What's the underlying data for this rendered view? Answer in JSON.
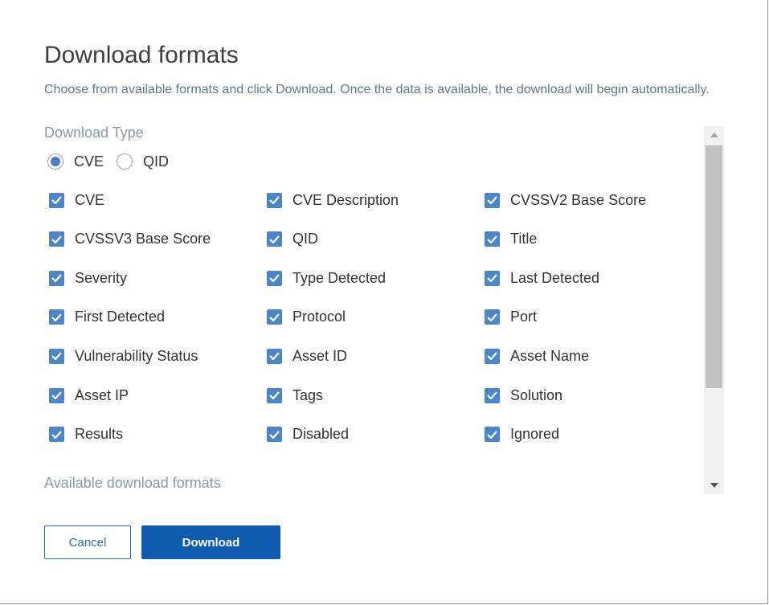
{
  "dialog": {
    "title": "Download formats",
    "description": "Choose from available formats and click Download. Once the data is available, the download will begin automatically."
  },
  "download_type": {
    "label": "Download Type",
    "options": [
      {
        "label": "CVE",
        "selected": true
      },
      {
        "label": "QID",
        "selected": false
      }
    ]
  },
  "fields": [
    {
      "label": "CVE",
      "checked": true
    },
    {
      "label": "CVE Description",
      "checked": true
    },
    {
      "label": "CVSSV2 Base Score",
      "checked": true
    },
    {
      "label": "CVSSV3 Base Score",
      "checked": true
    },
    {
      "label": "QID",
      "checked": true
    },
    {
      "label": "Title",
      "checked": true
    },
    {
      "label": "Severity",
      "checked": true
    },
    {
      "label": "Type Detected",
      "checked": true
    },
    {
      "label": "Last Detected",
      "checked": true
    },
    {
      "label": "First Detected",
      "checked": true
    },
    {
      "label": "Protocol",
      "checked": true
    },
    {
      "label": "Port",
      "checked": true
    },
    {
      "label": "Vulnerability Status",
      "checked": true
    },
    {
      "label": "Asset ID",
      "checked": true
    },
    {
      "label": "Asset Name",
      "checked": true
    },
    {
      "label": "Asset IP",
      "checked": true
    },
    {
      "label": "Tags",
      "checked": true
    },
    {
      "label": "Solution",
      "checked": true
    },
    {
      "label": "Results",
      "checked": true
    },
    {
      "label": "Disabled",
      "checked": true
    },
    {
      "label": "Ignored",
      "checked": true
    }
  ],
  "formats": {
    "label": "Available download formats"
  },
  "buttons": {
    "cancel": "Cancel",
    "download": "Download"
  },
  "colors": {
    "accent": "#0f5bb0",
    "checkbox": "#4a86c8"
  }
}
